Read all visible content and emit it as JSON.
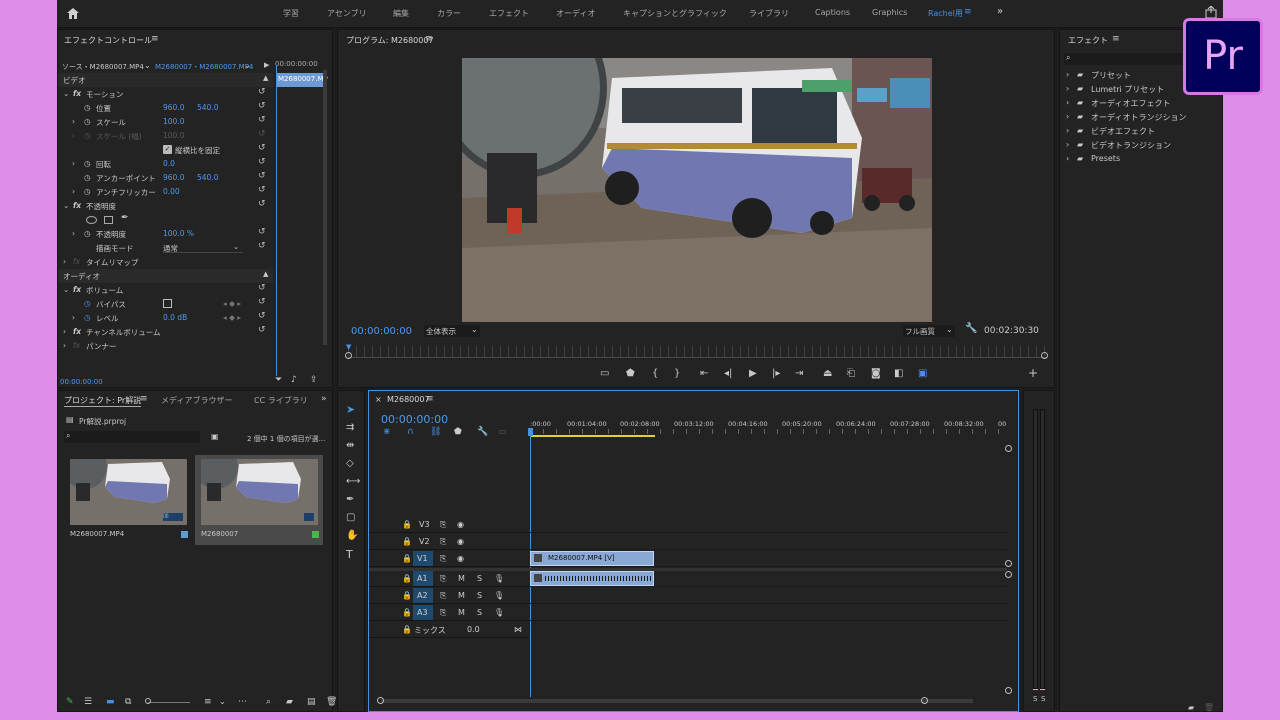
{
  "brand": {
    "pr_logo": "Pr",
    "accent": "#4a90e2",
    "frame": "#de8de8"
  },
  "workspaces": [
    "学習",
    "アセンブリ",
    "編集",
    "カラー",
    "エフェクト",
    "オーディオ",
    "キャプションとグラフィック",
    "ライブラリ",
    "Captions",
    "Graphics",
    "Rachel用"
  ],
  "effect_controls": {
    "title": "エフェクトコントロール",
    "source": "ソース・M2680007.MP4",
    "sequence": "M2680007・M2680007.MP4",
    "timeline_clip": "M2680007.MP",
    "timecode": "00:00:00:00",
    "sections": {
      "video": "ビデオ",
      "audio": "オーディオ"
    },
    "motion": "モーション",
    "position": {
      "label": "位置",
      "x": "960.0",
      "y": "540.0"
    },
    "scale": {
      "label": "スケール",
      "value": "100.0"
    },
    "scale_width": {
      "label": "スケール (幅)",
      "value": "100.0"
    },
    "uniform_scale": "縦横比を固定",
    "rotation": {
      "label": "回転",
      "value": "0.0"
    },
    "anchor": {
      "label": "アンカーポイント",
      "x": "960.0",
      "y": "540.0"
    },
    "antiflicker": {
      "label": "アンチフリッカー",
      "value": "0.00"
    },
    "opacity_group": "不透明度",
    "opacity": {
      "label": "不透明度",
      "value": "100.0 %"
    },
    "blend": {
      "label": "描画モード",
      "value": "通常"
    },
    "time_remap": "タイムリマップ",
    "volume": "ボリューム",
    "bypass": "バイパス",
    "level": {
      "label": "レベル",
      "value": "0.0 dB"
    },
    "channel_volume": "チャンネルボリューム",
    "panner": "パンナー"
  },
  "program": {
    "title": "プログラム: M2680007",
    "timecode": "00:00:00:00",
    "zoom": "全体表示",
    "quality": "フル画質",
    "duration": "00:02:30:30"
  },
  "effects_panel": {
    "title": "エフェクト",
    "items": [
      "プリセット",
      "Lumetri プリセット",
      "オーディオエフェクト",
      "オーディオトランジション",
      "ビデオエフェクト",
      "ビデオトランジション",
      "Presets"
    ]
  },
  "project": {
    "tabs": [
      "プロジェクト: Pr解説",
      "メディアブラウザー",
      "CC ライブラリ"
    ],
    "file": "Pr解説.prproj",
    "selection": "2 個中 1 個の項目が選...",
    "items": [
      {
        "name": "M2680007.MP4"
      },
      {
        "name": "M2680007"
      }
    ]
  },
  "timeline": {
    "tab": "M2680007",
    "timecode": "00:00:00:00",
    "ruler": [
      ":00:00",
      "00:01:04:00",
      "00:02:08:00",
      "00:03:12:00",
      "00:04:16:00",
      "00:05:20:00",
      "00:06:24:00",
      "00:07:28:00",
      "00:08:32:00",
      "00"
    ],
    "video_tracks": [
      "V3",
      "V2",
      "V1"
    ],
    "audio_tracks": [
      "A1",
      "A2",
      "A3"
    ],
    "mix": {
      "label": "ミックス",
      "value": "0.0"
    },
    "mute": "M",
    "solo": "S",
    "video_clip": "M2680007.MP4 [V]",
    "meter_labels": [
      "S",
      "S"
    ]
  }
}
